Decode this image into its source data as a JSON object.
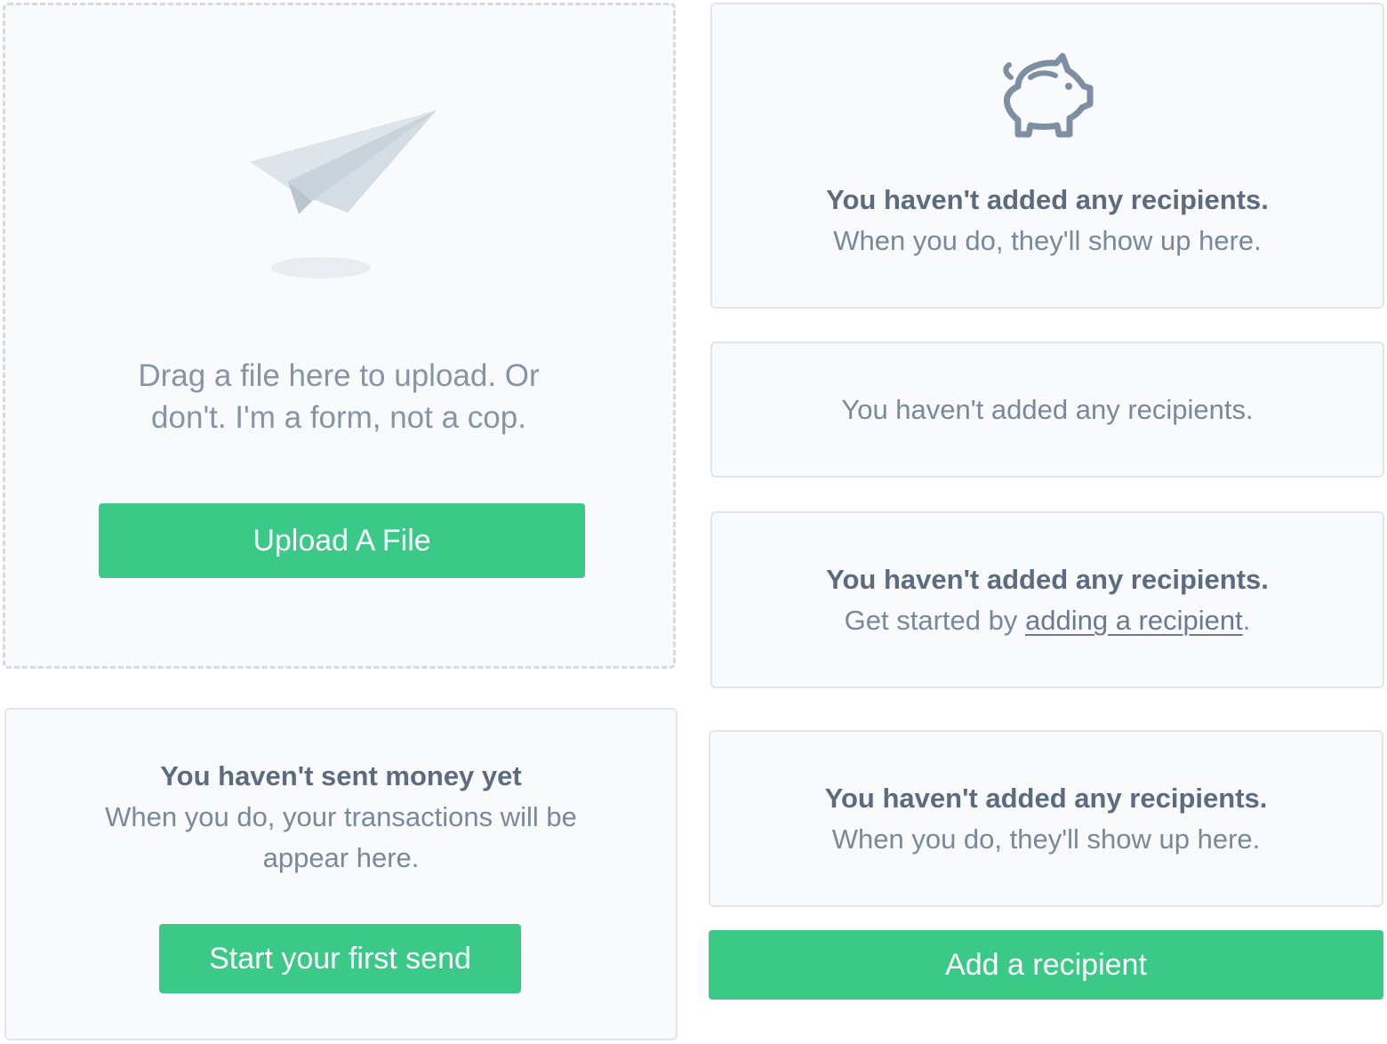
{
  "upload_card": {
    "message": "Drag a file here to upload. Or don't. I'm a form, not a cop.",
    "button_label": "Upload A File"
  },
  "send_card": {
    "title": "You haven't sent money yet",
    "body": "When you do, your transactions will be appear here.",
    "button_label": "Start your first send"
  },
  "recipients_card_icon": {
    "icon": "piggy-bank-icon",
    "title": "You haven't added any recipients.",
    "body": "When you do, they'll show up here."
  },
  "recipients_card_simple": {
    "body": "You haven't added any recipients."
  },
  "recipients_card_link": {
    "title": "You haven't added any recipients.",
    "body_prefix": "Get started by ",
    "link_label": "adding a recipient",
    "body_suffix": "."
  },
  "recipients_card_button": {
    "title": "You haven't added any recipients.",
    "body": "When you do, they'll show up here.",
    "button_label": "Add a recipient"
  },
  "colors": {
    "accent": "#3ac986",
    "card_background": "#f8fafb",
    "border": "#e2e6ec",
    "text": "#6b7a90"
  }
}
